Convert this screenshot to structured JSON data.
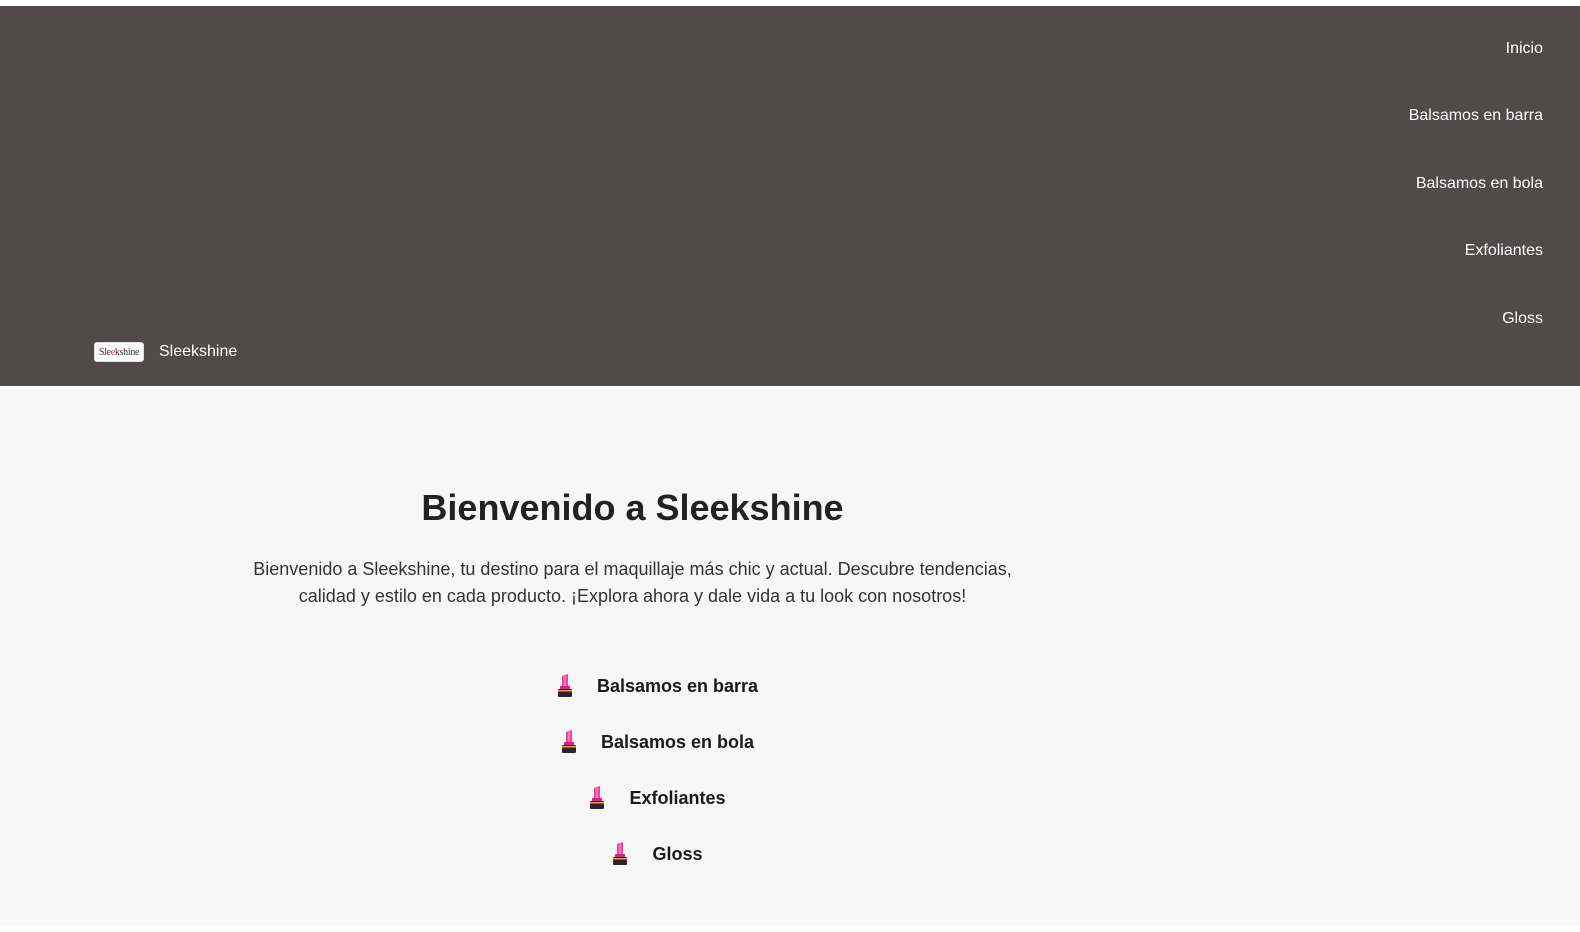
{
  "header": {
    "background": "#504a4a",
    "brand": {
      "logo_text_part1": "Sle",
      "logo_text_accent": "e",
      "logo_text_part2": "kshine",
      "name": "Sleekshine"
    },
    "nav": [
      {
        "label": "Inicio"
      },
      {
        "label": "Balsamos en barra"
      },
      {
        "label": "Balsamos en bola"
      },
      {
        "label": "Exfoliantes"
      },
      {
        "label": "Gloss"
      }
    ]
  },
  "main": {
    "title": "Bienvenido a Sleekshine",
    "intro": "Bienvenido a Sleekshine, tu destino para el maquillaje más chic y actual. Descubre tendencias, calidad y estilo en cada producto. ¡Explora ahora y dale vida a tu look con nosotros!",
    "products": [
      {
        "icon": "lipstick-icon",
        "label": "Balsamos en barra"
      },
      {
        "icon": "lipstick-icon",
        "label": "Balsamos en bola"
      },
      {
        "icon": "lipstick-icon",
        "label": "Exfoliantes"
      },
      {
        "icon": "lipstick-icon",
        "label": "Gloss"
      }
    ]
  },
  "colors": {
    "accent": "#e0217b",
    "page_background": "#f7f7f7"
  }
}
